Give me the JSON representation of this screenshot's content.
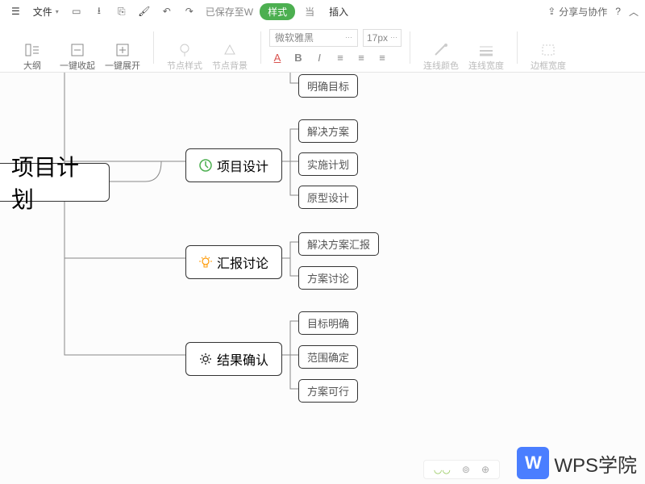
{
  "menubar": {
    "file": "文件",
    "save_status_prefix": "已保存至W",
    "pill": "样式",
    "after_pill": "当",
    "insert": "插入",
    "share": "分享与协作",
    "help": "?"
  },
  "ribbon": {
    "outline": "大纲",
    "collapse": "一键收起",
    "expand": "一键展开",
    "node_style": "节点样式",
    "node_bg": "节点背景",
    "font_name": "微软雅黑",
    "font_size": "17px",
    "line_color": "连线颜色",
    "line_width": "连线宽度",
    "border_width": "边框宽度"
  },
  "mindmap": {
    "root": "项目计划",
    "branches": [
      {
        "label": "项目设计",
        "icon": "compass",
        "icon_color": "#4caf50",
        "leaves": [
          "解决方案",
          "实施计划",
          "原型设计"
        ]
      },
      {
        "label": "汇报讨论",
        "icon": "bulb",
        "icon_color": "#ff9800",
        "leaves": [
          "解决方案汇报",
          "方案讨论"
        ]
      },
      {
        "label": "结果确认",
        "icon": "gear",
        "icon_color": "#333",
        "leaves": [
          "目标明确",
          "范围确定",
          "方案可行"
        ]
      }
    ],
    "orphan_leaf": "明确目标"
  },
  "watermark": {
    "logo": "W",
    "text": "WPS学院"
  }
}
